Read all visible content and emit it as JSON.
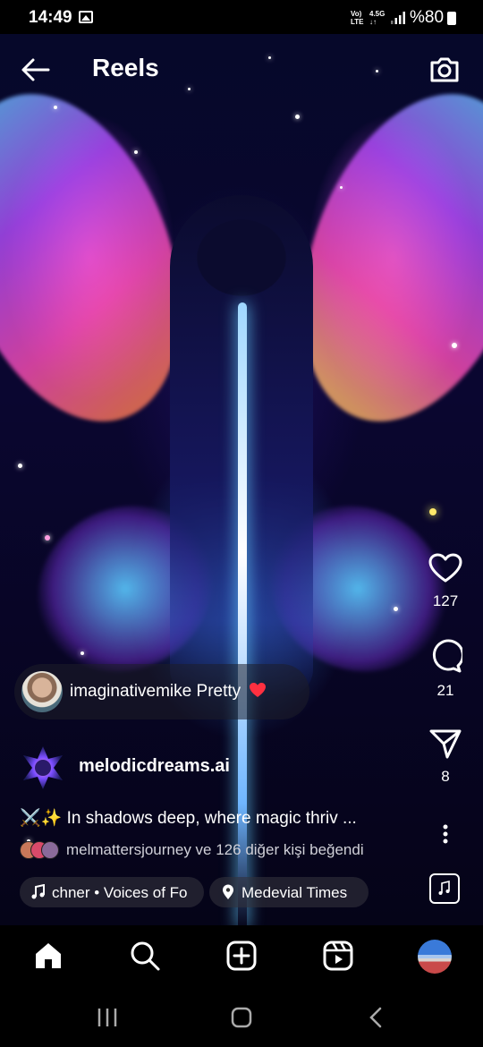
{
  "status_bar": {
    "time": "14:49",
    "network_label_top": "Vo)",
    "network_label_bottom": "LTE",
    "network_type": "4.5G",
    "battery": "%80",
    "icons": [
      "gallery-icon",
      "signal-icon",
      "battery-icon"
    ]
  },
  "header": {
    "title": "Reels",
    "icons": [
      "back-arrow-icon",
      "camera-icon"
    ]
  },
  "actions": {
    "likes": "127",
    "comments": "21",
    "shares": "8",
    "icons": [
      "heart-icon",
      "comment-icon",
      "send-icon",
      "more-icon",
      "audio-icon"
    ]
  },
  "comment_preview": {
    "user": "imaginativemike",
    "text": "Pretty"
  },
  "owner": {
    "username": "melodicdreams.ai"
  },
  "caption": "⚔️✨ In shadows deep, where magic thriv ...",
  "liked_by": "melmattersjourney ve 126 diğer kişi beğendi",
  "music_chip": "chner • Voices of Fo",
  "location_chip": "Medevial Times",
  "bottom_nav": {
    "items": [
      "home-icon",
      "search-icon",
      "create-icon",
      "reels-icon",
      "profile-avatar"
    ]
  },
  "colors": {
    "accent_heart": "#ff3040",
    "background": "#000000"
  }
}
